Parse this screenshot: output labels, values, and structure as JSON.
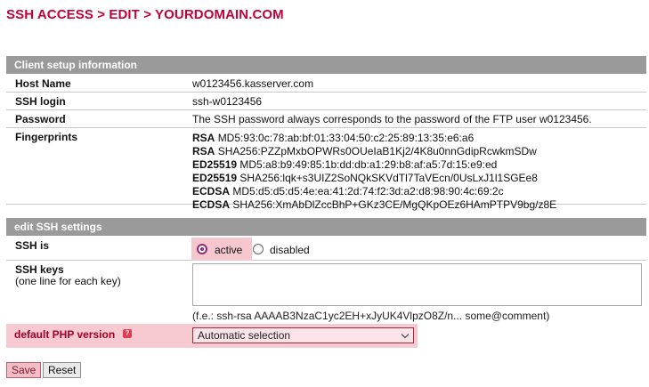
{
  "page": {
    "title": "SSH ACCESS > EDIT > YOURDOMAIN.COM"
  },
  "client_setup": {
    "heading": "Client setup information",
    "host_label": "Host Name",
    "host_value": "w0123456.kasserver.com",
    "login_label": "SSH login",
    "login_value": "ssh-w0123456",
    "password_label": "Password",
    "password_value": "The SSH password always corresponds to the password of the FTP user w0123456.",
    "fingerprints_label": "Fingerprints",
    "fingerprints": [
      {
        "algo": "RSA",
        "value": "MD5:93:0c:78:ab:bf:01:33:04:50:c2:25:89:13:35:e6:a6"
      },
      {
        "algo": "RSA",
        "value": "SHA256:PZZpMxbOPWRs0OUeIaB1Kj2/4K8u0nnGdipRcwkmSDw"
      },
      {
        "algo": "ED25519",
        "value": "MD5:a8:b9:49:85:1b:dd:db:a1:29:b8:af:a5:7d:15:e9:ed"
      },
      {
        "algo": "ED25519",
        "value": "SHA256:lqk+s3UIZ2SoNQkSKVdTl7TaVEcn/0UsLxJ1l1SGEe8"
      },
      {
        "algo": "ECDSA",
        "value": "MD5:d5:d5:d5:4e:ea:41:2d:74:f2:3d:a2:d8:98:90:4c:69:2c"
      },
      {
        "algo": "ECDSA",
        "value": "SHA256:XmAbDlZccBhP+GKz3CE/MgQKpOEz6HAmPTPV9bg/z8E"
      }
    ]
  },
  "edit_ssh": {
    "heading": "edit SSH settings",
    "ssh_is_label": "SSH is",
    "option_active": "active",
    "option_disabled": "disabled",
    "selected": "active",
    "keys_label": "SSH keys",
    "keys_sublabel": "(one line for each key)",
    "keys_value": "",
    "keys_hint": "(f.e.: ssh-rsa AAAAB3NzaC1yc2EH+xJyUK4VlpzO8Z/n... some@comment)",
    "php_label": "default PHP version",
    "php_selected": "Automatic selection"
  },
  "buttons": {
    "save": "Save",
    "reset": "Reset"
  },
  "colors": {
    "accent": "#c2003a",
    "section_bar": "#9a9a9a",
    "highlight": "#f6c7cf"
  }
}
